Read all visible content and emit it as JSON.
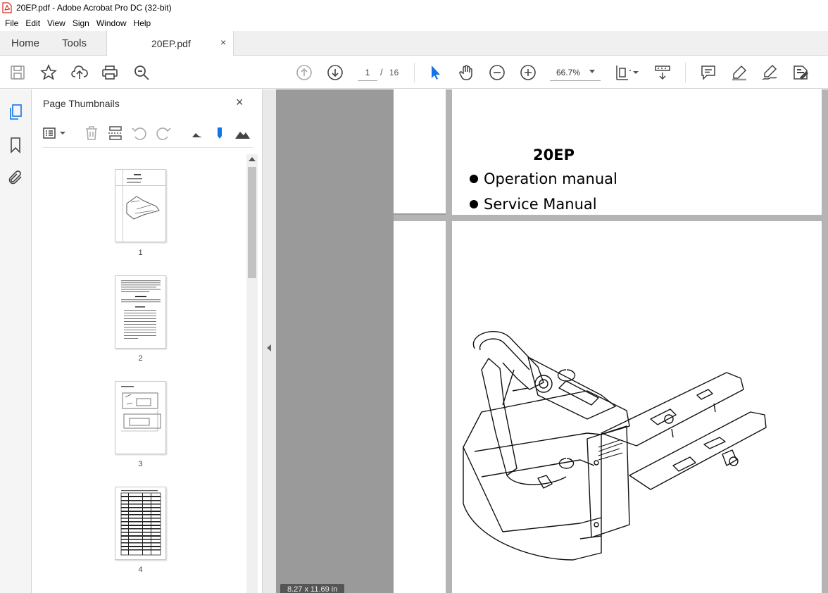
{
  "window": {
    "title": "20EP.pdf - Adobe Acrobat Pro DC (32-bit)"
  },
  "menu": {
    "items": [
      "File",
      "Edit",
      "View",
      "Sign",
      "Window",
      "Help"
    ]
  },
  "tabs": {
    "home": "Home",
    "tools": "Tools",
    "document": "20EP.pdf",
    "close": "×"
  },
  "toolbar": {
    "icons": [
      "save-icon",
      "bookmark-star-icon",
      "upload-icon",
      "print-icon",
      "zoom-search-icon",
      "page-up-icon",
      "page-down-icon",
      "select-cursor-icon",
      "hand-icon",
      "zoom-out-icon",
      "zoom-in-icon",
      "page-fit-icon",
      "scroll-mode-icon",
      "comment-icon",
      "highlight-icon",
      "sign-icon",
      "redact-icon"
    ],
    "current_page": "1",
    "page_separator": "/",
    "total_pages": "16",
    "zoom": "66.7%"
  },
  "thumbnails_panel": {
    "title": "Page Thumbnails",
    "close": "×",
    "pages": [
      {
        "number": "1"
      },
      {
        "number": "2"
      },
      {
        "number": "3"
      },
      {
        "number": "4"
      }
    ]
  },
  "document": {
    "title": "20EP",
    "bullets": [
      "Operation manual",
      "Service Manual"
    ],
    "page_size": "8.27 x 11.69 in"
  },
  "colors": {
    "accent": "#1473e6",
    "pdf_red": "#d7261e",
    "doc_background": "#9a9a9a"
  }
}
